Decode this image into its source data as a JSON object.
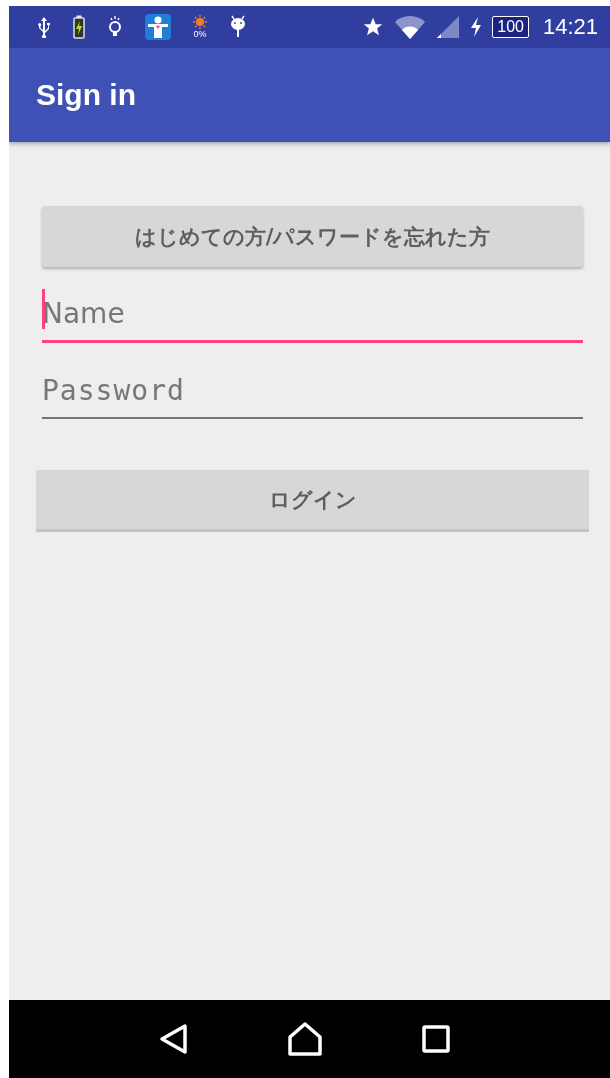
{
  "status_bar": {
    "data_saver_reading": "0%",
    "battery": "100",
    "time": "14:21"
  },
  "app_bar": {
    "title": "Sign in"
  },
  "form": {
    "help_button": "はじめての方/パスワードを忘れた方",
    "fields": [
      {
        "kind": "text",
        "placeholder": "Name",
        "focused": true
      },
      {
        "kind": "password",
        "placeholder": "Password",
        "focused": false
      }
    ],
    "login_button": "ログイン"
  }
}
